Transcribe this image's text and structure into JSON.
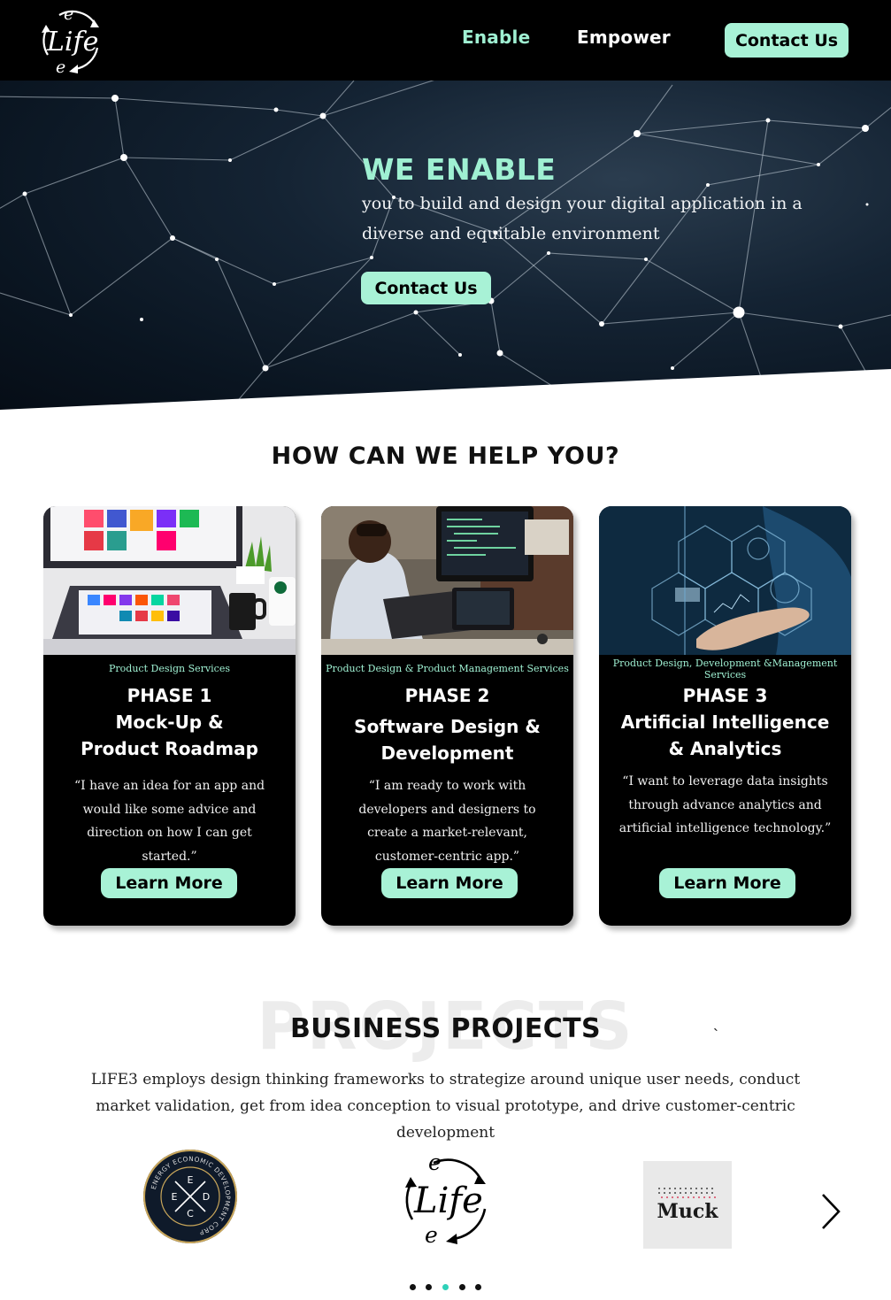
{
  "nav": {
    "logo_text": "Life",
    "logo_letter_top": "e",
    "logo_letter_bottom": "e",
    "links": [
      "Enable",
      "Empower"
    ],
    "contact_label": "Contact Us"
  },
  "hero": {
    "title": "WE ENABLE",
    "text": "you to build and design your digital application in a diverse and equitable environment",
    "button_label": "Contact Us"
  },
  "help": {
    "title": "HOW CAN WE HELP YOU?",
    "cards": [
      {
        "subtitle": "Product Design Services",
        "title_lines": [
          "PHASE 1",
          "Mock-Up &",
          "Product Roadmap"
        ],
        "quote": "“I have an idea for an app and would like some advice and direction on how I can get started.”",
        "button_label": "Learn More"
      },
      {
        "subtitle": "Product Design & Product Management Services",
        "title_lines": [
          "PHASE 2",
          "Software Design &",
          "Development"
        ],
        "quote": "“I am ready to work with developers and designers to create a market-relevant, customer-centric app.”",
        "button_label": "Learn More"
      },
      {
        "subtitle": "Product Design, Development &Management Services",
        "title_lines": [
          "PHASE 3",
          "Artificial Intelligence",
          "& Analytics"
        ],
        "quote": "“I want to leverage data insights through advance analytics and artificial intelligence technology.”",
        "button_label": "Learn More"
      }
    ]
  },
  "projects": {
    "ghost": "PROJECTS",
    "title": "BUSINESS PROJECTS",
    "stray_mark": "`",
    "description": "LIFE3 employs design thinking frameworks to strategize around unique user needs, conduct market validation, get from idea conception to visual prototype, and drive customer-centric development",
    "logos": [
      {
        "name": "eedc",
        "ring_text": "ENERGY ECONOMIC DEVELOPMENT CORP",
        "letters": [
          "E",
          "E",
          "D",
          "C"
        ]
      },
      {
        "name": "life3",
        "text": "Life",
        "letter": "e"
      },
      {
        "name": "muck",
        "text": "Muck"
      }
    ],
    "carousel_dots": 5,
    "active_dot": 2
  },
  "colors": {
    "accent": "#a8f2d6",
    "accent_text": "#9ff0d2",
    "nav_bg": "#000000",
    "card_bg": "#000000",
    "active_dot": "#2ed1b8"
  }
}
